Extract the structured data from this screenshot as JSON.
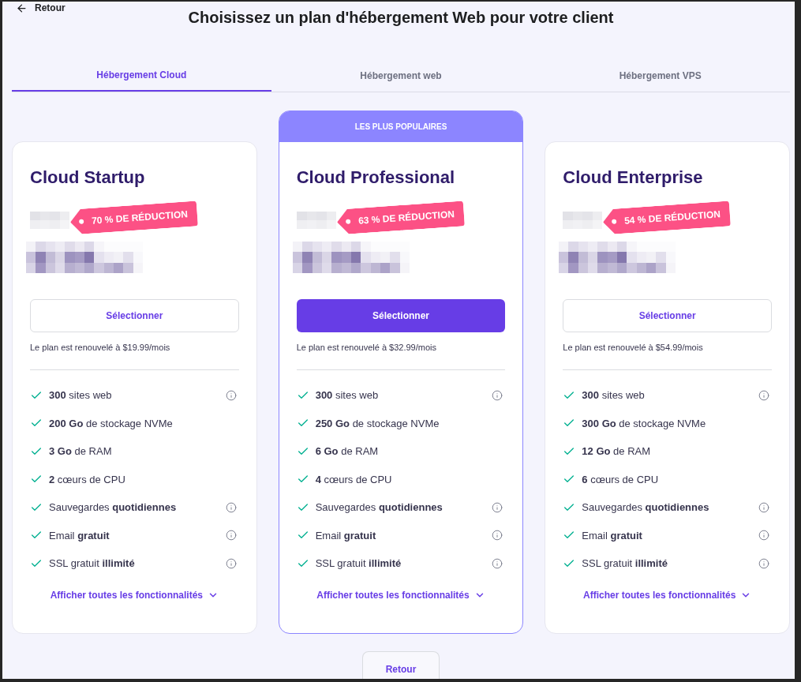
{
  "back_link": {
    "label": "Retour"
  },
  "title": "Choisissez un plan d'hébergement Web pour votre client",
  "tabs": [
    {
      "label": "Hébergement Cloud",
      "selected": true
    },
    {
      "label": "Hébergement web",
      "selected": false
    },
    {
      "label": "Hébergement VPS",
      "selected": false
    }
  ],
  "plans": [
    {
      "name": "Cloud Startup",
      "featured": false,
      "discount": "70 % DE RÉDUCTION",
      "button": "Sélectionner",
      "renewal": "Le plan est renouvelé à $19.99/mois",
      "features": [
        {
          "text": "**300** sites web",
          "info": true
        },
        {
          "text": "**200 Go** de stockage NVMe",
          "info": false
        },
        {
          "text": "**3 Go** de RAM",
          "info": false
        },
        {
          "text": "**2** cœurs de CPU",
          "info": false
        },
        {
          "text": "Sauvegardes **quotidiennes**",
          "info": true
        },
        {
          "text": "Email **gratuit**",
          "info": true
        },
        {
          "text": "SSL gratuit **illimité**",
          "info": true
        }
      ],
      "more_link": "Afficher toutes les fonctionnalités"
    },
    {
      "name": "Cloud Professional",
      "badge": "LES PLUS POPULAIRES",
      "featured": true,
      "discount": "63 % DE RÉDUCTION",
      "button": "Sélectionner",
      "renewal": "Le plan est renouvelé à $32.99/mois",
      "features": [
        {
          "text": "**300** sites web",
          "info": true
        },
        {
          "text": "**250 Go** de stockage NVMe",
          "info": false
        },
        {
          "text": "**6 Go** de RAM",
          "info": false
        },
        {
          "text": "**4** cœurs de CPU",
          "info": false
        },
        {
          "text": "Sauvegardes **quotidiennes**",
          "info": true
        },
        {
          "text": "Email **gratuit**",
          "info": true
        },
        {
          "text": "SSL gratuit **illimité**",
          "info": true
        }
      ],
      "more_link": "Afficher toutes les fonctionnalités"
    },
    {
      "name": "Cloud Enterprise",
      "featured": false,
      "discount": "54 % DE RÉDUCTION",
      "button": "Sélectionner",
      "renewal": "Le plan est renouvelé à $54.99/mois",
      "features": [
        {
          "text": "**300** sites web",
          "info": true
        },
        {
          "text": "**300 Go** de stockage NVMe",
          "info": false
        },
        {
          "text": "**12 Go** de RAM",
          "info": false
        },
        {
          "text": "**6** cœurs de CPU",
          "info": false
        },
        {
          "text": "Sauvegardes **quotidiennes**",
          "info": true
        },
        {
          "text": "Email **gratuit**",
          "info": true
        },
        {
          "text": "SSL gratuit **illimité**",
          "info": true
        }
      ],
      "more_link": "Afficher toutes les fonctionnalités"
    }
  ],
  "footer_button": {
    "label": "Retour"
  }
}
